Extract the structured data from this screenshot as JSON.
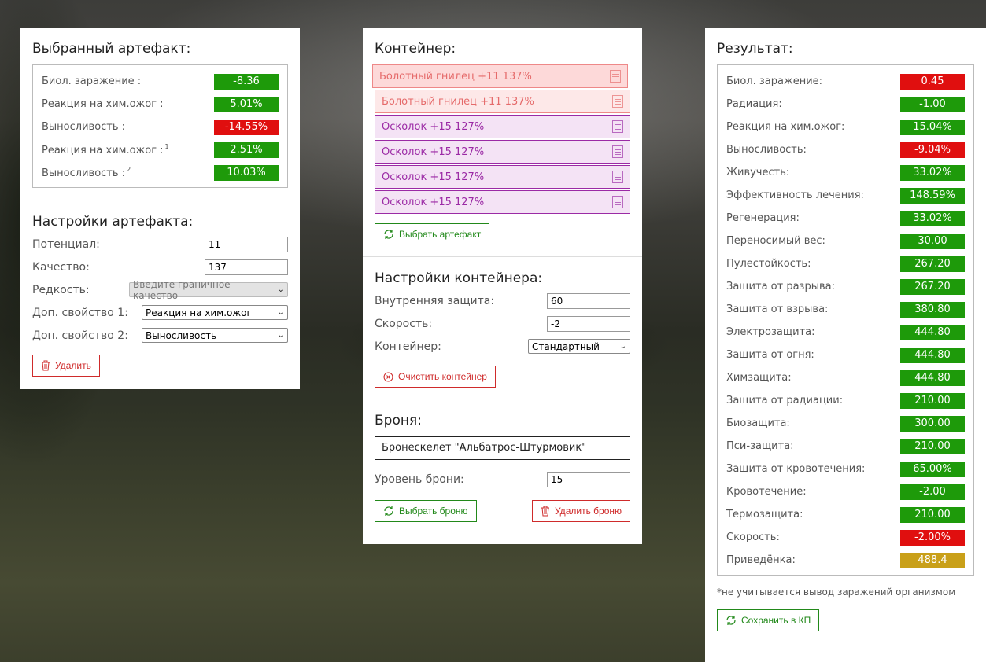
{
  "artifact": {
    "title": "Выбранный артефакт:",
    "stats": [
      {
        "label": "Биол. заражение :",
        "sup": "",
        "value": "-8.36",
        "color": "green"
      },
      {
        "label": "Реакция на хим.ожог :",
        "sup": "",
        "value": "5.01%",
        "color": "green"
      },
      {
        "label": "Выносливость :",
        "sup": "",
        "value": "-14.55%",
        "color": "red"
      },
      {
        "label": "Реакция на хим.ожог :",
        "sup": "1",
        "value": "2.51%",
        "color": "green"
      },
      {
        "label": "Выносливость :",
        "sup": "2",
        "value": "10.03%",
        "color": "green"
      }
    ],
    "settings_title": "Настройки артефакта:",
    "potential_label": "Потенциал:",
    "potential_value": "11",
    "quality_label": "Качество:",
    "quality_value": "137",
    "rarity_label": "Редкость:",
    "rarity_value": "Введите граничное качество",
    "extra1_label": "Доп. свойство 1:",
    "extra1_value": "Реакция на хим.ожог",
    "extra2_label": "Доп. свойство 2:",
    "extra2_value": "Выносливость",
    "delete_label": "Удалить"
  },
  "container": {
    "title": "Контейнер:",
    "items": [
      {
        "label": "Болотный гнилец +11 137%",
        "style": "red"
      },
      {
        "label": "Болотный гнилец +11 137%",
        "style": "red2"
      },
      {
        "label": "Осколок +15 127%",
        "style": "purple"
      },
      {
        "label": "Осколок +15 127%",
        "style": "purple"
      },
      {
        "label": "Осколок +15 127%",
        "style": "purple"
      },
      {
        "label": "Осколок +15 127%",
        "style": "purple"
      }
    ],
    "choose_label": "Выбрать артефакт",
    "settings_title": "Настройки контейнера:",
    "inner_protection_label": "Внутренняя защита:",
    "inner_protection_value": "60",
    "speed_label": "Скорость:",
    "speed_value": "-2",
    "container_label": "Контейнер:",
    "container_value": "Стандартный",
    "clear_label": "Очистить контейнер"
  },
  "armor": {
    "title": "Броня:",
    "name": "Бронескелет \"Альбатрос-Штурмовик\"",
    "level_label": "Уровень брони:",
    "level_value": "15",
    "choose_label": "Выбрать броню",
    "delete_label": "Удалить броню"
  },
  "result": {
    "title": "Результат:",
    "stats": [
      {
        "label": "Биол. заражение:",
        "value": "0.45",
        "color": "red"
      },
      {
        "label": "Радиация:",
        "value": "-1.00",
        "color": "green"
      },
      {
        "label": "Реакция на хим.ожог:",
        "value": "15.04%",
        "color": "green"
      },
      {
        "label": "Выносливость:",
        "value": "-9.04%",
        "color": "red"
      },
      {
        "label": "Живучесть:",
        "value": "33.02%",
        "color": "green"
      },
      {
        "label": "Эффективность лечения:",
        "value": "148.59%",
        "color": "green"
      },
      {
        "label": "Регенерация:",
        "value": "33.02%",
        "color": "green"
      },
      {
        "label": "Переносимый вес:",
        "value": "30.00",
        "color": "green"
      },
      {
        "label": "Пулестойкость:",
        "value": "267.20",
        "color": "green"
      },
      {
        "label": "Защита от разрыва:",
        "value": "267.20",
        "color": "green"
      },
      {
        "label": "Защита от взрыва:",
        "value": "380.80",
        "color": "green"
      },
      {
        "label": "Электрозащита:",
        "value": "444.80",
        "color": "green"
      },
      {
        "label": "Защита от огня:",
        "value": "444.80",
        "color": "green"
      },
      {
        "label": "Химзащита:",
        "value": "444.80",
        "color": "green"
      },
      {
        "label": "Защита от радиации:",
        "value": "210.00",
        "color": "green"
      },
      {
        "label": "Биозащита:",
        "value": "300.00",
        "color": "green"
      },
      {
        "label": "Пси-защита:",
        "value": "210.00",
        "color": "green"
      },
      {
        "label": "Защита от кровотечения:",
        "value": "65.00%",
        "color": "green"
      },
      {
        "label": "Кровотечение:",
        "value": "-2.00",
        "color": "green"
      },
      {
        "label": "Термозащита:",
        "value": "210.00",
        "color": "green"
      },
      {
        "label": "Скорость:",
        "value": "-2.00%",
        "color": "red"
      },
      {
        "label": "Приведёнка:",
        "value": "488.4",
        "color": "yellow"
      }
    ],
    "footnote": "*не учитывается вывод заражений организмом",
    "save_label": "Сохранить в КП"
  },
  "colors": {
    "green": "#1e9a0a",
    "red": "#e00f0f",
    "yellow": "#c9a019",
    "button_green": "#22891a",
    "button_red": "#cf2b2b",
    "purple": "#9b2aa5"
  }
}
